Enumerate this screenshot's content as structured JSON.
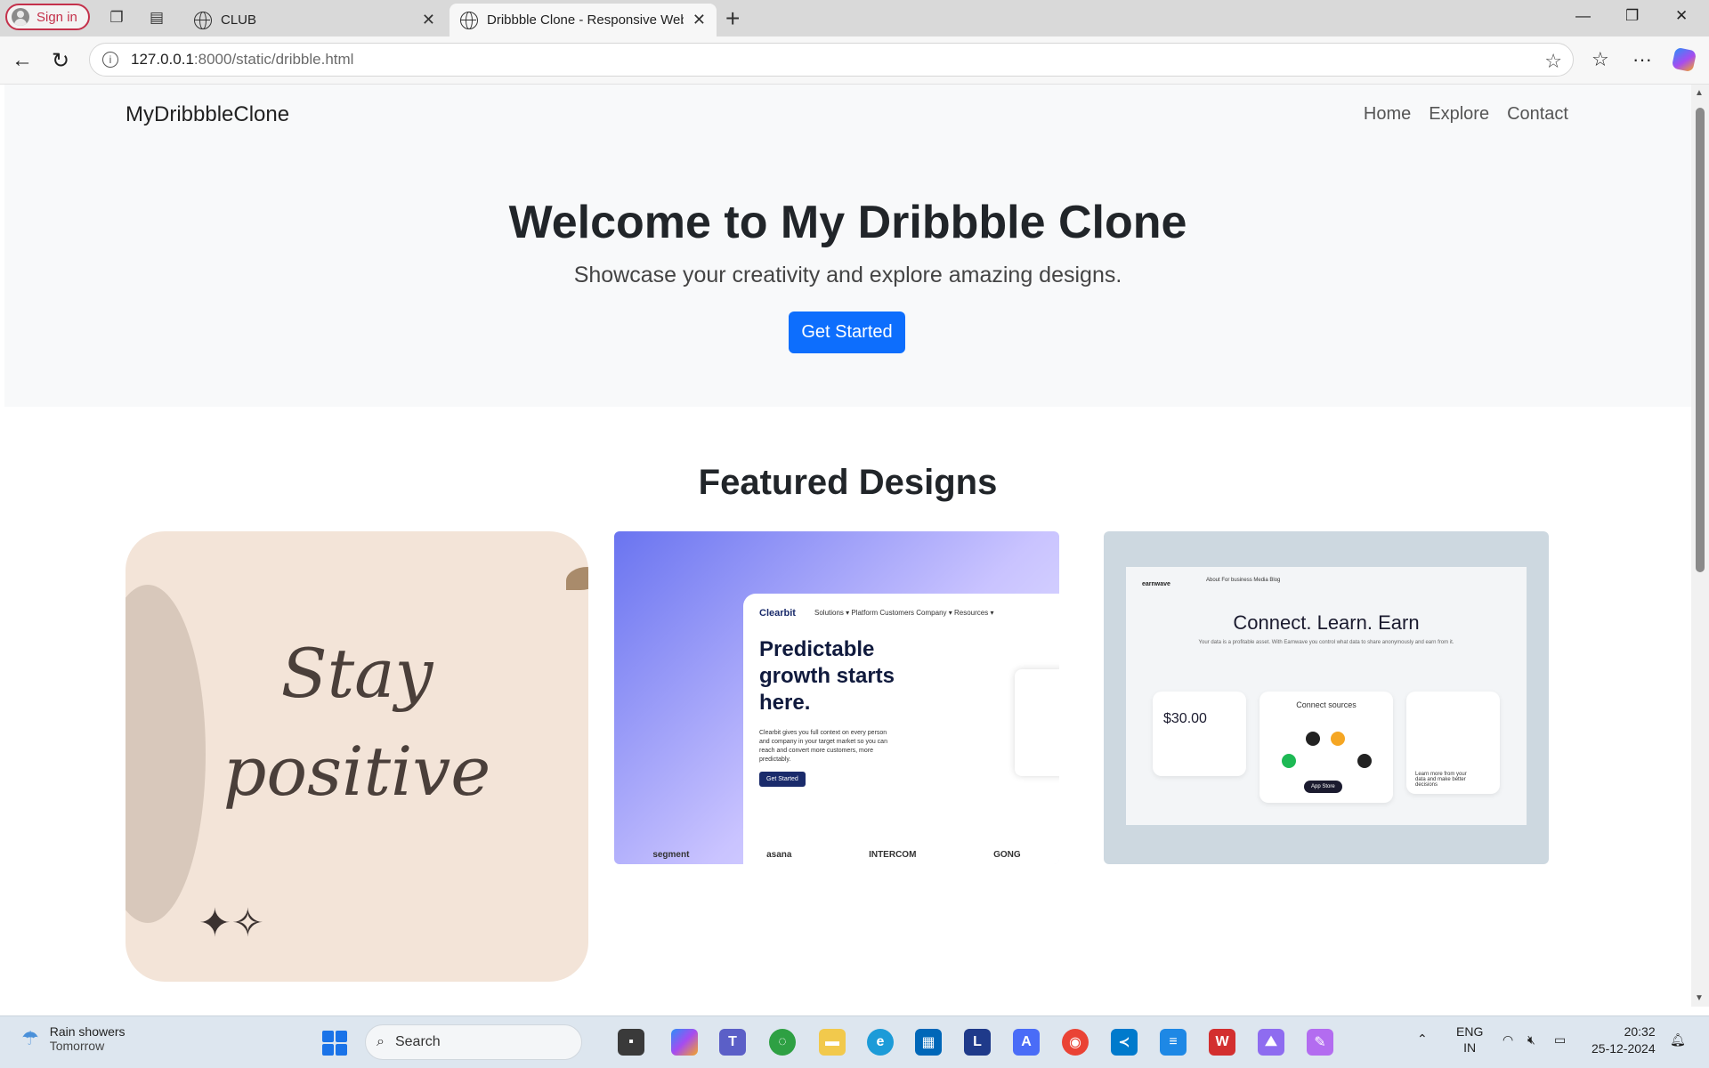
{
  "browser": {
    "signin_label": "Sign in",
    "tabs": [
      {
        "label": "CLUB",
        "active": false
      },
      {
        "label": "Dribbble Clone - Responsive Web",
        "active": true
      }
    ],
    "url_host": "127.0.0.1",
    "url_path": ":8000/static/dribble.html"
  },
  "page": {
    "brand": "MyDribbbleClone",
    "nav": [
      "Home",
      "Explore",
      "Contact"
    ],
    "hero": {
      "title": "Welcome to My Dribbble Clone",
      "subtitle": "Showcase your creativity and explore amazing designs.",
      "cta": "Get Started"
    },
    "section_title": "Featured Designs",
    "cards": [
      {
        "image_text_line1": "Stay",
        "image_text_line2": "positive"
      },
      {
        "logo": "Clearbit",
        "menu": "Solutions ▾   Platform   Customers   Company ▾   Resources ▾",
        "headline": "Predictable growth starts here.",
        "body": "Clearbit gives you full context on every person and company in your target market so you can reach and convert more customers, more predictably.",
        "button": "Get Started",
        "logos": [
          "segment",
          "asana",
          "INTERCOM",
          "GONG"
        ]
      },
      {
        "logo": "earnwave",
        "menu": "About   For business   Media   Blog",
        "headline": "Connect. Learn. Earn",
        "subhead": "Your data is a profitable asset. With Earnwave you control what data to share anonymously and earn from it.",
        "amount": "$30.00",
        "connect": "Connect sources",
        "store": "App Store",
        "learn": "Learn more from your data and make better decisions"
      }
    ]
  },
  "taskbar": {
    "weather_title": "Rain showers",
    "weather_sub": "Tomorrow",
    "search_placeholder": "Search",
    "lang1": "ENG",
    "lang2": "IN",
    "time": "20:32",
    "date": "25-12-2024"
  },
  "colors": {
    "primary": "#0d6efd",
    "navbar_bg": "#f8f9fa"
  }
}
